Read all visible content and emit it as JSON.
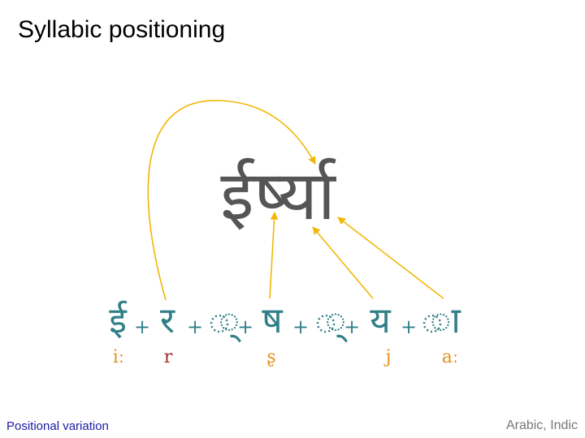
{
  "title": "Syllabic positioning",
  "result_word": "ईर्ष्या",
  "components": [
    "ई",
    "र",
    "्",
    "ष",
    "्",
    "य",
    "ा"
  ],
  "plus": "+",
  "transliterations": [
    {
      "text": "iː",
      "color": "#e5921b"
    },
    {
      "text": "r",
      "color": "#a52a2a"
    },
    {
      "text": "ʂ",
      "color": "#e5921b"
    },
    {
      "text": "j",
      "color": "#e5921b"
    },
    {
      "text": "aː",
      "color": "#e5921b"
    }
  ],
  "arrow_color": "#f2b705",
  "footer": {
    "left": "Positional variation",
    "right": "Arabic, Indic"
  }
}
